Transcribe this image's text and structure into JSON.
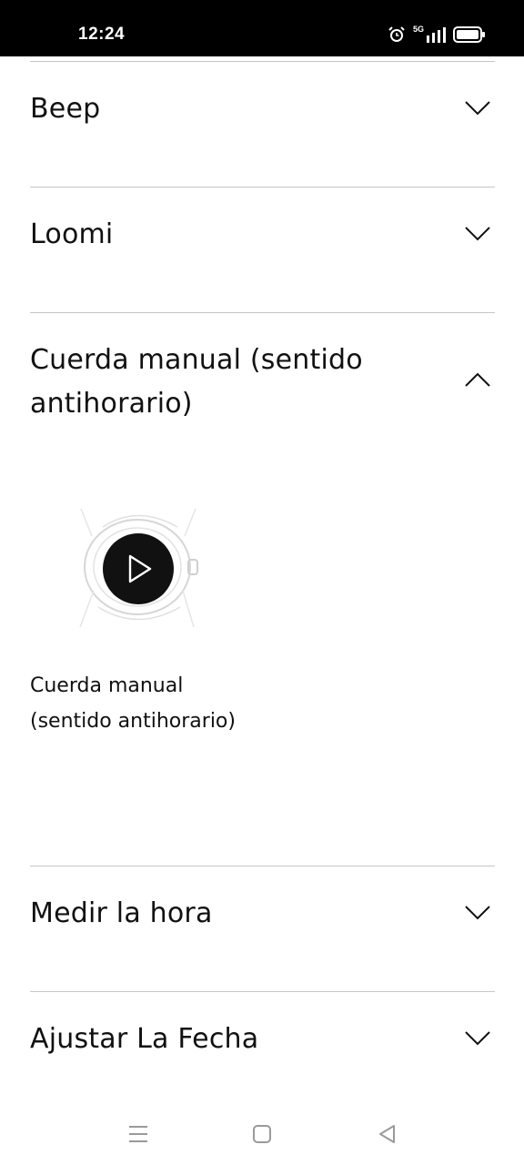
{
  "status_bar": {
    "time": "12:24",
    "network": "5G",
    "icons": [
      "alarm-icon",
      "signal-icon",
      "battery-icon"
    ]
  },
  "accordion": {
    "items": [
      {
        "title": "Beep",
        "state": "collapsed"
      },
      {
        "title": "Loomi",
        "state": "collapsed"
      },
      {
        "title": "Cuerda manual (sentido antihorario)",
        "state": "expanded",
        "video": {
          "caption": "Cuerda manual (sentido antihorario)",
          "icon": "play-icon"
        }
      },
      {
        "title": "Medir la hora",
        "state": "collapsed"
      },
      {
        "title": "Ajustar La Fecha",
        "state": "collapsed"
      }
    ]
  },
  "nav_bar": {
    "buttons": [
      "menu-icon",
      "home-icon",
      "back-icon"
    ]
  }
}
